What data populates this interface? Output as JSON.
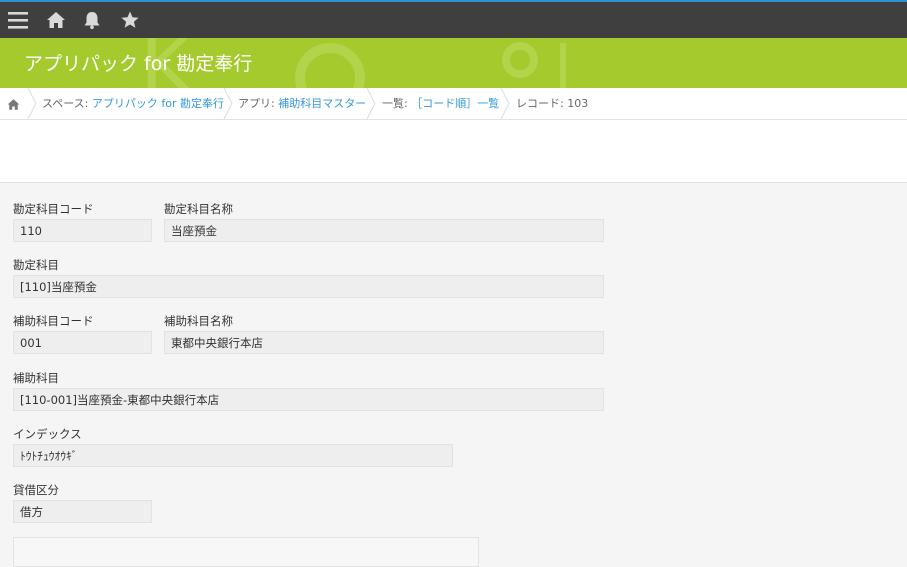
{
  "colors": {
    "header": "#3f3f3f",
    "banner": "#a4ca2e",
    "link": "#3498db"
  },
  "header": {
    "icons": [
      "menu-icon",
      "home-icon",
      "bell-icon",
      "star-icon"
    ]
  },
  "banner": {
    "title": "アプリパック for 勘定奉行"
  },
  "breadcrumb": {
    "space_prefix": "スペース: ",
    "space_link": "アプリパック for 勘定奉行",
    "app_prefix": "アプリ: ",
    "app_link": "補助科目マスター",
    "list_prefix": "一覧: ",
    "list_link": "［コード順］一覧",
    "record": "レコード: 103"
  },
  "record": {
    "account_code": {
      "label": "勘定科目コード",
      "value": "110"
    },
    "account_name": {
      "label": "勘定科目名称",
      "value": "当座預金"
    },
    "account": {
      "label": "勘定科目",
      "value": "[110]当座預金"
    },
    "sub_code": {
      "label": "補助科目コード",
      "value": "001"
    },
    "sub_name": {
      "label": "補助科目名称",
      "value": "東都中央銀行本店"
    },
    "sub_account": {
      "label": "補助科目",
      "value": "[110-001]当座預金-東都中央銀行本店"
    },
    "index": {
      "label": "インデックス",
      "value": "ﾄｳﾄﾁｭｳｵｳｷﾞ"
    },
    "debit_credit": {
      "label": "貸借区分",
      "value": "借方"
    }
  }
}
